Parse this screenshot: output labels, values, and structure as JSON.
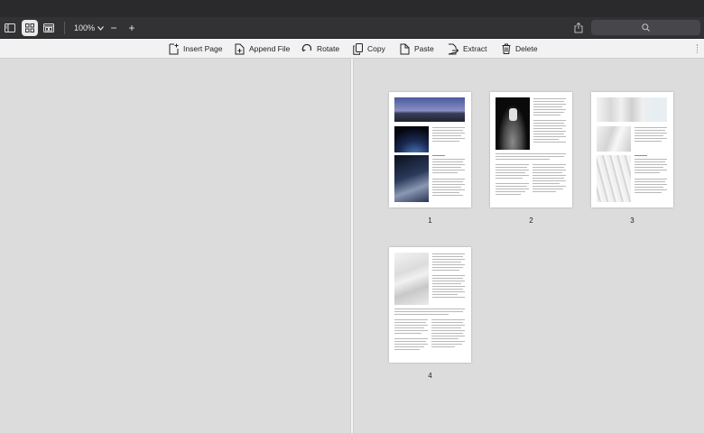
{
  "toolbar": {
    "zoom_value": "100%",
    "zoom_minus": "−",
    "zoom_plus": "+",
    "icons": [
      "sidebar-icon",
      "grid-view-icon",
      "page-layout-icon",
      "share-icon",
      "search-icon"
    ]
  },
  "commands": [
    {
      "label": "Insert Page",
      "icon": "insert-page-icon"
    },
    {
      "label": "Append File",
      "icon": "append-file-icon"
    },
    {
      "label": "Rotate",
      "icon": "rotate-icon"
    },
    {
      "label": "Copy",
      "icon": "copy-icon"
    },
    {
      "label": "Paste",
      "icon": "paste-icon"
    },
    {
      "label": "Extract",
      "icon": "extract-icon"
    },
    {
      "label": "Delete",
      "icon": "trash-icon"
    }
  ],
  "pages": [
    {
      "number": "1"
    },
    {
      "number": "2"
    },
    {
      "number": "3"
    },
    {
      "number": "4"
    }
  ],
  "colors": {
    "titlebar": "#2a2a2d",
    "toolbar": "#323235",
    "cmdbar": "#f2f2f2",
    "pane": "#dcdcdc"
  }
}
